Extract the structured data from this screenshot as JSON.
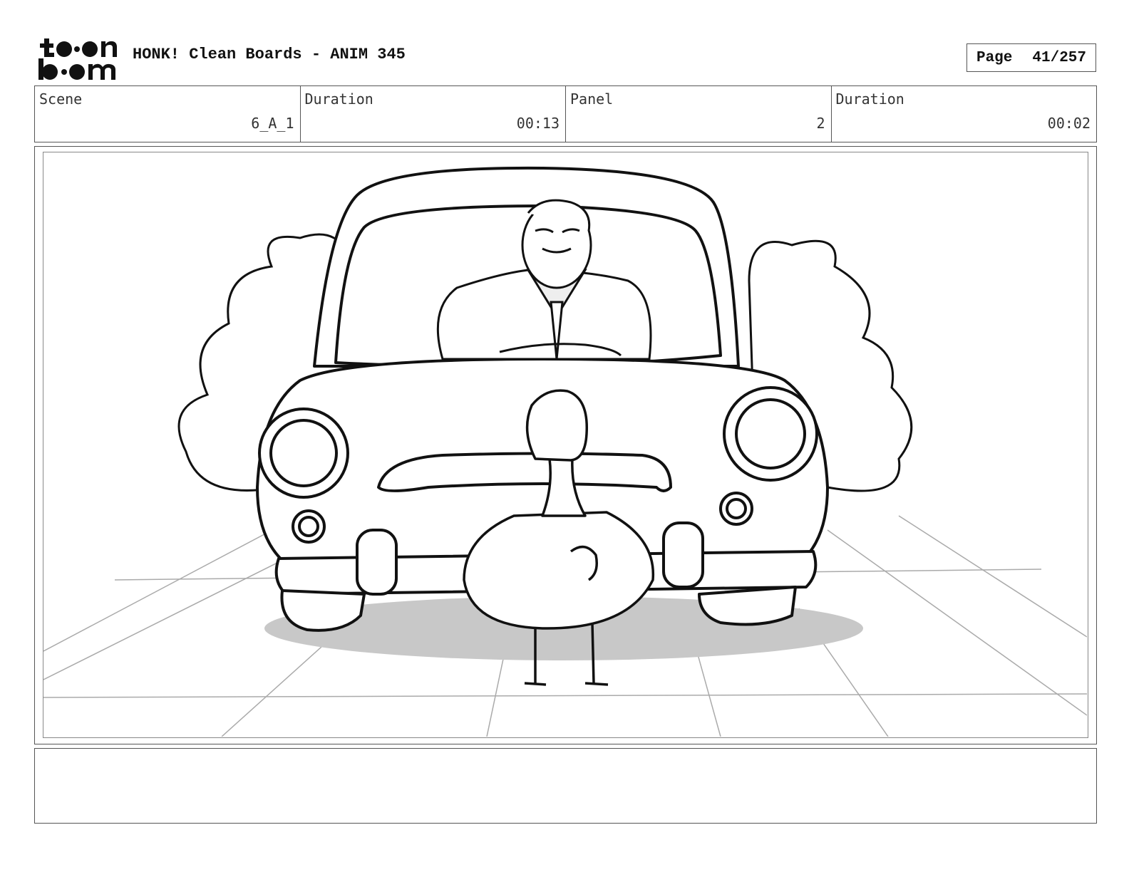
{
  "brand": {
    "logo_line1": "toon",
    "logo_line2": "boom"
  },
  "header": {
    "title": "HONK! Clean Boards - ANIM 345",
    "page_label": "Page",
    "page_value": "41/257"
  },
  "info": {
    "scene_label": "Scene",
    "scene_value": "6_A_1",
    "scene_duration_label": "Duration",
    "scene_duration_value": "00:13",
    "panel_label": "Panel",
    "panel_value": "2",
    "panel_duration_label": "Duration",
    "panel_duration_value": "00:02"
  },
  "notes": {
    "text": ""
  },
  "colors": {
    "ink": "#111111",
    "shadow": "#c8c8c8",
    "frame": "#555555"
  }
}
